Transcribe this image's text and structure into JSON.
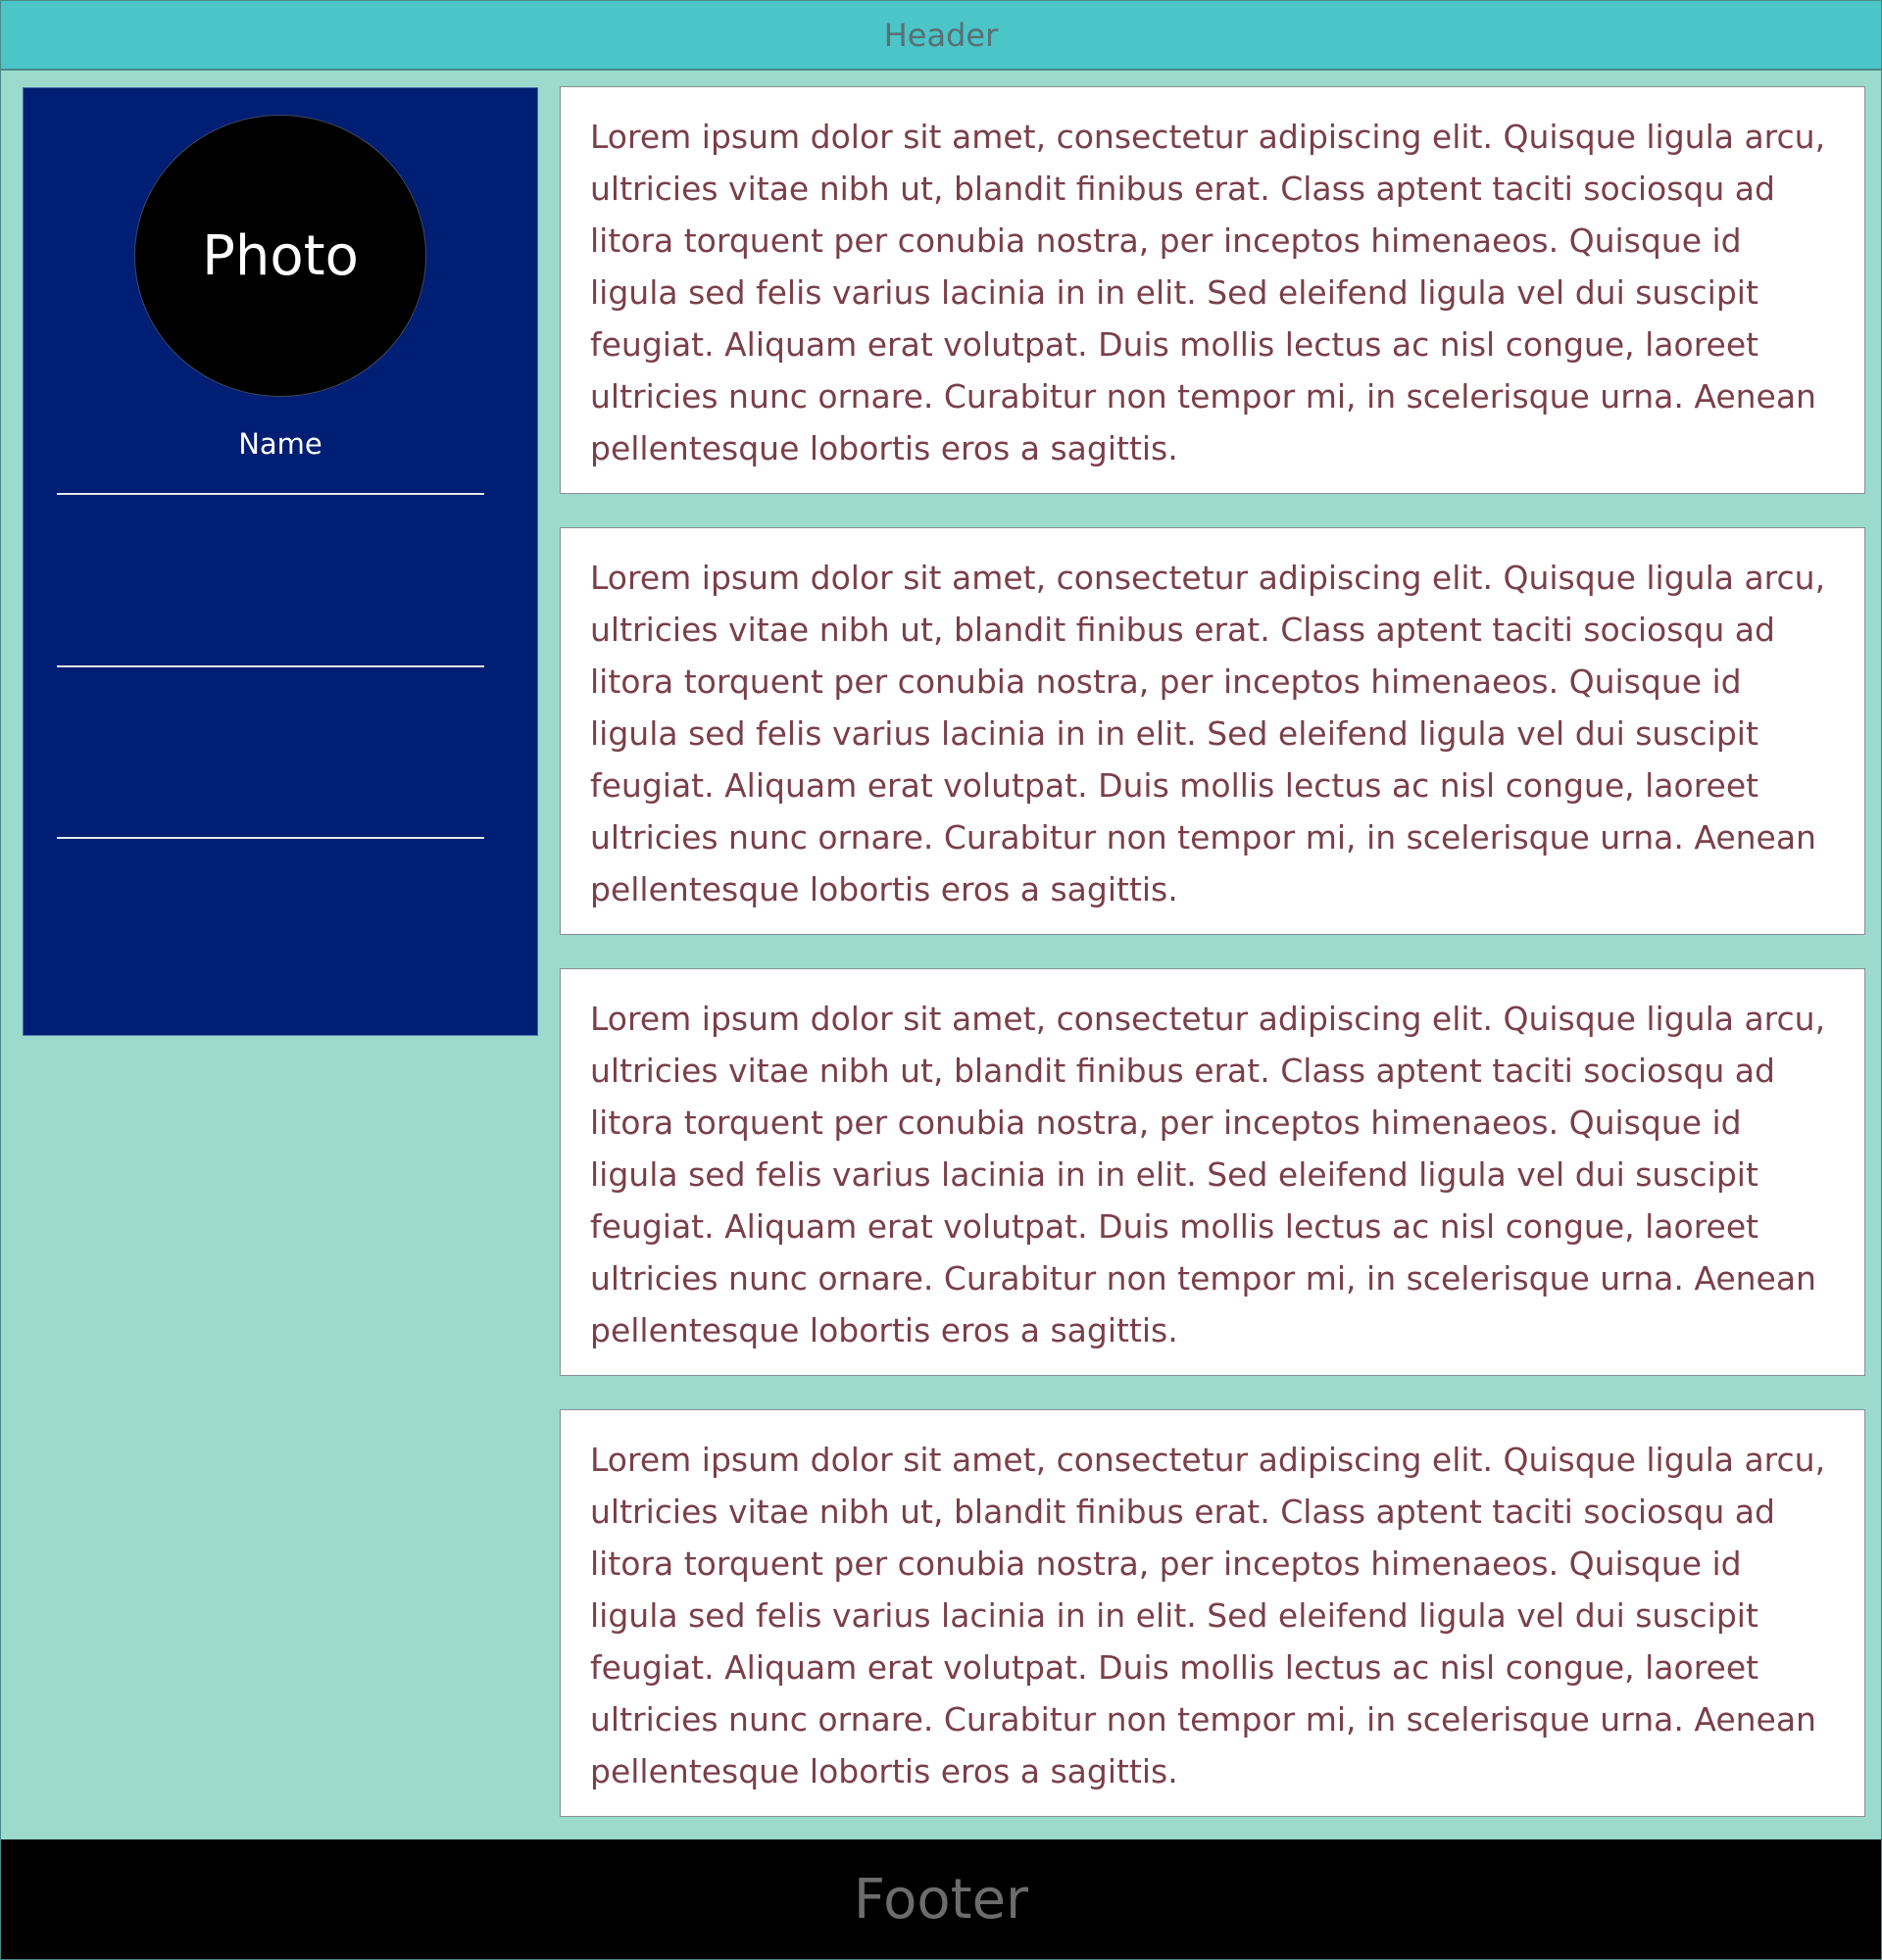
{
  "header": {
    "title": "Header"
  },
  "sidebar": {
    "photo_label": "Photo",
    "name_label": "Name"
  },
  "main": {
    "cards": [
      {
        "text": "Lorem ipsum dolor sit amet, consectetur adipiscing elit. Quisque ligula arcu, ultricies vitae nibh ut, blandit finibus erat. Class aptent taciti sociosqu ad litora torquent per conubia nostra, per inceptos himenaeos. Quisque id ligula sed felis varius lacinia in in elit. Sed eleifend ligula vel dui suscipit feugiat. Aliquam erat volutpat. Duis mollis lectus ac nisl congue, laoreet ultricies nunc ornare. Curabitur non tempor mi, in scelerisque urna. Aenean pellentesque lobortis eros a sagittis."
      },
      {
        "text": "Lorem ipsum dolor sit amet, consectetur adipiscing elit. Quisque ligula arcu, ultricies vitae nibh ut, blandit finibus erat. Class aptent taciti sociosqu ad litora torquent per conubia nostra, per inceptos himenaeos. Quisque id ligula sed felis varius lacinia in in elit. Sed eleifend ligula vel dui suscipit feugiat. Aliquam erat volutpat. Duis mollis lectus ac nisl congue, laoreet ultricies nunc ornare. Curabitur non tempor mi, in scelerisque urna. Aenean pellentesque lobortis eros a sagittis."
      },
      {
        "text": "Lorem ipsum dolor sit amet, consectetur adipiscing elit. Quisque ligula arcu, ultricies vitae nibh ut, blandit finibus erat. Class aptent taciti sociosqu ad litora torquent per conubia nostra, per inceptos himenaeos. Quisque id ligula sed felis varius lacinia in in elit. Sed eleifend ligula vel dui suscipit feugiat. Aliquam erat volutpat. Duis mollis lectus ac nisl congue, laoreet ultricies nunc ornare. Curabitur non tempor mi, in scelerisque urna. Aenean pellentesque lobortis eros a sagittis."
      },
      {
        "text": "Lorem ipsum dolor sit amet, consectetur adipiscing elit. Quisque ligula arcu, ultricies vitae nibh ut, blandit finibus erat. Class aptent taciti sociosqu ad litora torquent per conubia nostra, per inceptos himenaeos. Quisque id ligula sed felis varius lacinia in in elit. Sed eleifend ligula vel dui suscipit feugiat. Aliquam erat volutpat. Duis mollis lectus ac nisl congue, laoreet ultricies nunc ornare. Curabitur non tempor mi, in scelerisque urna. Aenean pellentesque lobortis eros a sagittis."
      }
    ]
  },
  "footer": {
    "title": "Footer"
  },
  "colors": {
    "header_bg": "#4bc5c8",
    "page_bg": "#9bdacd",
    "sidebar_bg": "#001e73",
    "photo_bg": "#000000",
    "card_bg": "#ffffff",
    "card_text": "#7a3f4a",
    "footer_bg": "#000000"
  }
}
